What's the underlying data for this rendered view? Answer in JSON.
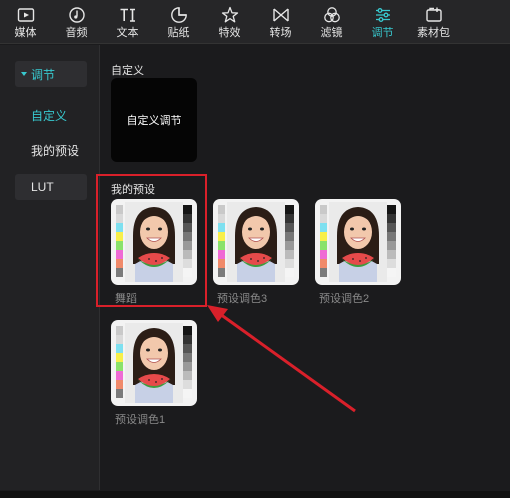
{
  "tabs": [
    {
      "label": "媒体",
      "icon": "media-icon"
    },
    {
      "label": "音频",
      "icon": "audio-icon"
    },
    {
      "label": "文本",
      "icon": "text-icon"
    },
    {
      "label": "贴纸",
      "icon": "sticker-icon"
    },
    {
      "label": "特效",
      "icon": "effects-icon"
    },
    {
      "label": "转场",
      "icon": "transition-icon"
    },
    {
      "label": "滤镜",
      "icon": "filter-icon"
    },
    {
      "label": "调节",
      "icon": "adjust-icon",
      "active": true
    },
    {
      "label": "素材包",
      "icon": "material-pack-icon"
    }
  ],
  "sidebar": {
    "category": "调节",
    "custom": "自定义",
    "my_presets": "我的预设",
    "lut": "LUT"
  },
  "main": {
    "custom_section_title": "自定义",
    "custom_card_label": "自定义调节",
    "presets_section_title": "我的预设",
    "presets": [
      {
        "name": "舞蹈"
      },
      {
        "name": "预设调色3"
      },
      {
        "name": "预设调色2"
      },
      {
        "name": "预设调色1"
      }
    ]
  },
  "colors": {
    "accent": "#38c9cf",
    "annotation": "#d9202a"
  }
}
